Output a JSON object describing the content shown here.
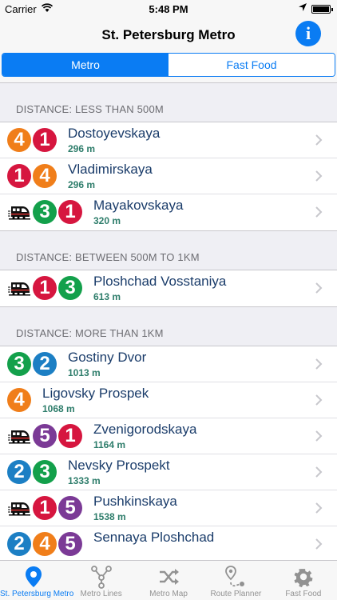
{
  "status": {
    "carrier": "Carrier",
    "time": "5:48 PM"
  },
  "nav": {
    "title": "St. Petersburg Metro",
    "info_icon": "info-icon"
  },
  "segments": [
    {
      "label": "Metro",
      "active": true
    },
    {
      "label": "Fast Food",
      "active": false
    }
  ],
  "colors": {
    "line1": "#d6163f",
    "line2": "#1c7fc4",
    "line3": "#13a04b",
    "line4": "#f07e1a",
    "line5": "#7b3a96",
    "accent": "#0a7cf3"
  },
  "sections": [
    {
      "header": "DISTANCE: LESS THAN 500M",
      "rows": [
        {
          "name": "Dostoyevskaya",
          "distance": "296 m",
          "train": false,
          "lines": [
            4,
            1
          ]
        },
        {
          "name": "Vladimirskaya",
          "distance": "296 m",
          "train": false,
          "lines": [
            1,
            4
          ]
        },
        {
          "name": "Mayakovskaya",
          "distance": "320 m",
          "train": true,
          "lines": [
            3,
            1
          ]
        }
      ]
    },
    {
      "header": "DISTANCE: BETWEEN 500M TO 1KM",
      "rows": [
        {
          "name": "Ploshchad Vosstaniya",
          "distance": "613 m",
          "train": true,
          "lines": [
            1,
            3
          ]
        }
      ]
    },
    {
      "header": "DISTANCE: MORE THAN 1KM",
      "rows": [
        {
          "name": "Gostiny Dvor",
          "distance": "1013 m",
          "train": false,
          "lines": [
            3,
            2
          ]
        },
        {
          "name": "Ligovsky Prospek",
          "distance": "1068 m",
          "train": false,
          "lines": [
            4
          ]
        },
        {
          "name": "Zvenigorodskaya",
          "distance": "1164 m",
          "train": true,
          "lines": [
            5,
            1
          ]
        },
        {
          "name": "Nevsky Prospekt",
          "distance": "1333 m",
          "train": false,
          "lines": [
            2,
            3
          ]
        },
        {
          "name": "Pushkinskaya",
          "distance": "1538 m",
          "train": true,
          "lines": [
            1,
            5
          ]
        },
        {
          "name": "Sennaya Ploshchad",
          "distance": "",
          "train": false,
          "lines": [
            2,
            4,
            5
          ]
        }
      ]
    }
  ],
  "tabs": [
    {
      "label": "St. Petersburg Metro",
      "icon": "location-pin-icon",
      "active": true
    },
    {
      "label": "Metro Lines",
      "icon": "metro-lines-icon",
      "active": false
    },
    {
      "label": "Metro Map",
      "icon": "shuffle-map-icon",
      "active": false
    },
    {
      "label": "Route Planner",
      "icon": "route-planner-icon",
      "active": false
    },
    {
      "label": "Fast Food",
      "icon": "gear-icon",
      "active": false
    }
  ]
}
